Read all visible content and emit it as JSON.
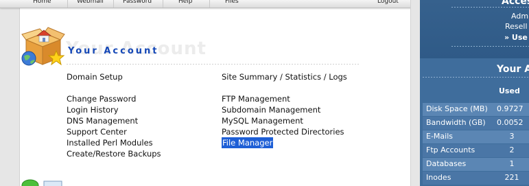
{
  "topnav": {
    "items": [
      "Home",
      "Webmail",
      "Password",
      "Help",
      "Files",
      "Logout"
    ]
  },
  "page": {
    "title": "Your Account",
    "title_shadow": "Your Account"
  },
  "menu": {
    "domain_setup": "Domain Setup",
    "site_summary": "Site Summary / Statistics / Logs",
    "left": [
      "Change Password",
      "Login History",
      "DNS Management",
      "Support Center",
      "Installed Perl Modules",
      "Create/Restore Backups"
    ],
    "right": [
      "FTP Management",
      "Subdomain Management",
      "MySQL Management",
      "Password Protected Directories",
      "File Manager"
    ],
    "selected": "File Manager"
  },
  "sidebar": {
    "access_title": "Acces",
    "links": [
      "Adm",
      "Resell",
      "» Use"
    ],
    "account_title": "Your A",
    "used_header": "Used",
    "stats": [
      {
        "label": "Disk Space (MB)",
        "value": "0.9727"
      },
      {
        "label": "Bandwidth (GB)",
        "value": "0.0052"
      },
      {
        "label": "E-Mails",
        "value": "3"
      },
      {
        "label": "Ftp Accounts",
        "value": "2"
      },
      {
        "label": "Databases",
        "value": "1"
      },
      {
        "label": "Inodes",
        "value": "221"
      }
    ]
  },
  "colors": {
    "title_blue": "#1548b7",
    "sidebar_blue": "#3f6d9c",
    "selection_blue": "#1e5fd6"
  }
}
